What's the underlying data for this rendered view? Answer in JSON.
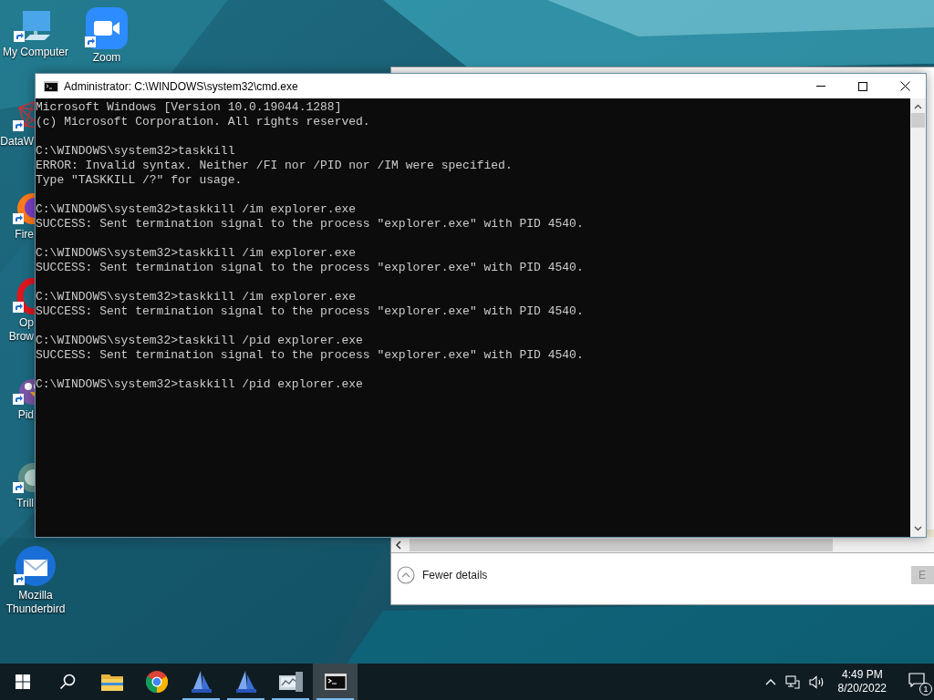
{
  "desktop_icons": [
    {
      "kind": "computer",
      "label_lines": [
        "My Computer"
      ]
    },
    {
      "kind": "zoom",
      "label_lines": [
        "Zoom"
      ]
    },
    {
      "kind": "network",
      "label_lines": [
        "DataW"
      ]
    },
    {
      "kind": "fox",
      "label_lines": [
        "Fire"
      ]
    },
    {
      "kind": "ring",
      "label_lines": [
        "Op",
        "Brow"
      ]
    },
    {
      "kind": "bird",
      "label_lines": [
        "Pid"
      ]
    },
    {
      "kind": "sphere",
      "label_lines": [
        "Trill"
      ]
    },
    {
      "kind": "mail",
      "label_lines": [
        "Mozilla",
        "Thunderbird"
      ]
    }
  ],
  "background_window": {
    "toggle": "Fewer details",
    "button": "E"
  },
  "console": {
    "title": "Administrator: C:\\WINDOWS\\system32\\cmd.exe",
    "blocks": [
      [
        "Microsoft Windows [Version 10.0.19044.1288]",
        "(c) Microsoft Corporation. All rights reserved."
      ],
      [
        "C:\\WINDOWS\\system32>taskkill",
        "ERROR: Invalid syntax. Neither /FI nor /PID nor /IM were specified.",
        "Type \"TASKKILL /?\" for usage."
      ],
      [
        "C:\\WINDOWS\\system32>taskkill /im explorer.exe",
        "SUCCESS: Sent termination signal to the process \"explorer.exe\" with PID 4540."
      ],
      [
        "C:\\WINDOWS\\system32>taskkill /im explorer.exe",
        "SUCCESS: Sent termination signal to the process \"explorer.exe\" with PID 4540."
      ],
      [
        "C:\\WINDOWS\\system32>taskkill /im explorer.exe",
        "SUCCESS: Sent termination signal to the process \"explorer.exe\" with PID 4540."
      ],
      [
        "C:\\WINDOWS\\system32>taskkill /pid explorer.exe",
        "SUCCESS: Sent termination signal to the process \"explorer.exe\" with PID 4540."
      ],
      [
        "C:\\WINDOWS\\system32>taskkill /pid explorer.exe"
      ]
    ]
  },
  "taskbar": {
    "apps": [
      {
        "kind": "start",
        "running": false,
        "active": false
      },
      {
        "kind": "search",
        "running": false,
        "active": false
      },
      {
        "kind": "folder",
        "running": false,
        "active": false
      },
      {
        "kind": "chrome",
        "running": false,
        "active": false
      },
      {
        "kind": "ship",
        "running": true,
        "active": false
      },
      {
        "kind": "ship",
        "running": true,
        "active": false
      },
      {
        "kind": "server",
        "running": true,
        "active": false
      },
      {
        "kind": "console",
        "running": true,
        "active": true
      }
    ],
    "clock": {
      "time": "4:49 PM",
      "date": "8/20/2022"
    },
    "notification_count": "1"
  }
}
